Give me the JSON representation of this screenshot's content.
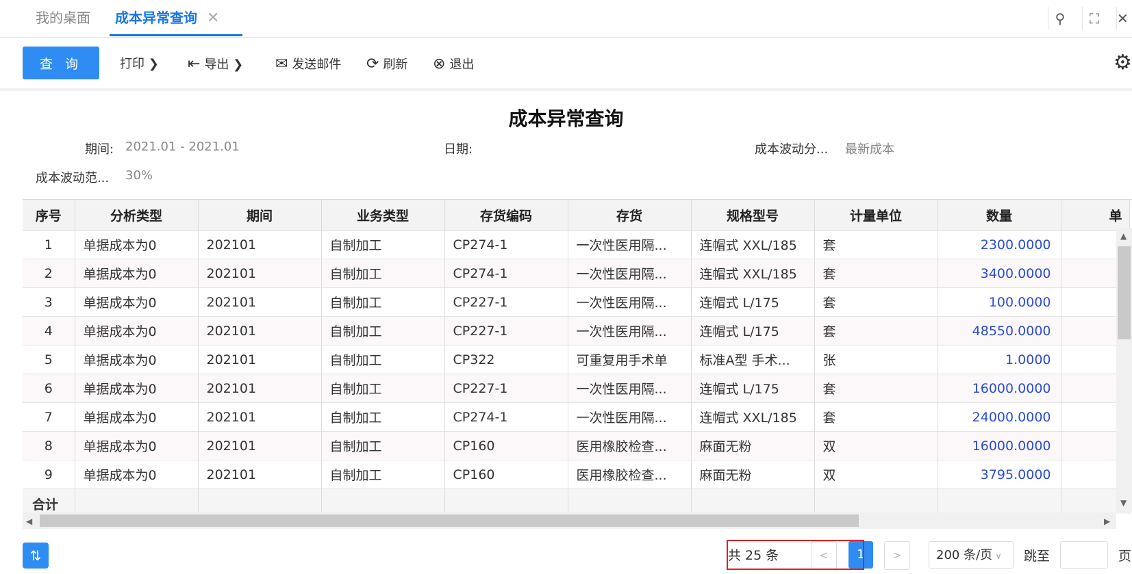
{
  "tabs": {
    "home": "我的桌面",
    "active": "成本异常查询",
    "close": "✕"
  },
  "toolbar": {
    "query": "查 询",
    "print": "打印",
    "export": "导出",
    "email": "发送邮件",
    "refresh": "刷新",
    "exit": "退出"
  },
  "report": {
    "title": "成本异常查询",
    "period_label": "期间:",
    "period_value": "2021.01 - 2021.01",
    "date_label": "日期:",
    "date_value": "",
    "analysis_label": "成本波动分...",
    "analysis_value": "最新成本",
    "range_label": "成本波动范...",
    "range_value": "30%"
  },
  "table": {
    "columns": [
      "序号",
      "分析类型",
      "期间",
      "业务类型",
      "存货编码",
      "存货",
      "规格型号",
      "计量单位",
      "数量",
      "单"
    ],
    "rows": [
      [
        "1",
        "单据成本为0",
        "202101",
        "自制加工",
        "CP274-1",
        "一次性医用隔...",
        "连帽式 XXL/185",
        "套",
        "2300.0000"
      ],
      [
        "2",
        "单据成本为0",
        "202101",
        "自制加工",
        "CP274-1",
        "一次性医用隔...",
        "连帽式 XXL/185",
        "套",
        "3400.0000"
      ],
      [
        "3",
        "单据成本为0",
        "202101",
        "自制加工",
        "CP227-1",
        "一次性医用隔...",
        "连帽式 L/175",
        "套",
        "100.0000"
      ],
      [
        "4",
        "单据成本为0",
        "202101",
        "自制加工",
        "CP227-1",
        "一次性医用隔...",
        "连帽式 L/175",
        "套",
        "48550.0000"
      ],
      [
        "5",
        "单据成本为0",
        "202101",
        "自制加工",
        "CP322",
        "可重复用手术单",
        "标准A型 手术...",
        "张",
        "1.0000"
      ],
      [
        "6",
        "单据成本为0",
        "202101",
        "自制加工",
        "CP227-1",
        "一次性医用隔...",
        "连帽式 L/175",
        "套",
        "16000.0000"
      ],
      [
        "7",
        "单据成本为0",
        "202101",
        "自制加工",
        "CP274-1",
        "一次性医用隔...",
        "连帽式 XXL/185",
        "套",
        "24000.0000"
      ],
      [
        "8",
        "单据成本为0",
        "202101",
        "自制加工",
        "CP160",
        "医用橡胶检查...",
        "麻面无粉",
        "双",
        "16000.0000"
      ],
      [
        "9",
        "单据成本为0",
        "202101",
        "自制加工",
        "CP160",
        "医用橡胶检查...",
        "麻面无粉",
        "双",
        "3795.0000"
      ]
    ],
    "total_label": "合计"
  },
  "footer": {
    "total": "共 25 条",
    "prev": "<",
    "current_page": "1",
    "next": ">",
    "page_size": "200 条/页",
    "jump_label": "跳至",
    "page_suffix": "页"
  },
  "colors": {
    "accent": "#2f8cf3",
    "number_text": "#2b4bd6",
    "highlight_border": "#e02020"
  },
  "icons": [
    "search-icon",
    "fullscreen-icon",
    "close-icon",
    "export-icon",
    "email-icon",
    "refresh-icon",
    "exit-icon",
    "gear-icon",
    "sort-icon"
  ]
}
